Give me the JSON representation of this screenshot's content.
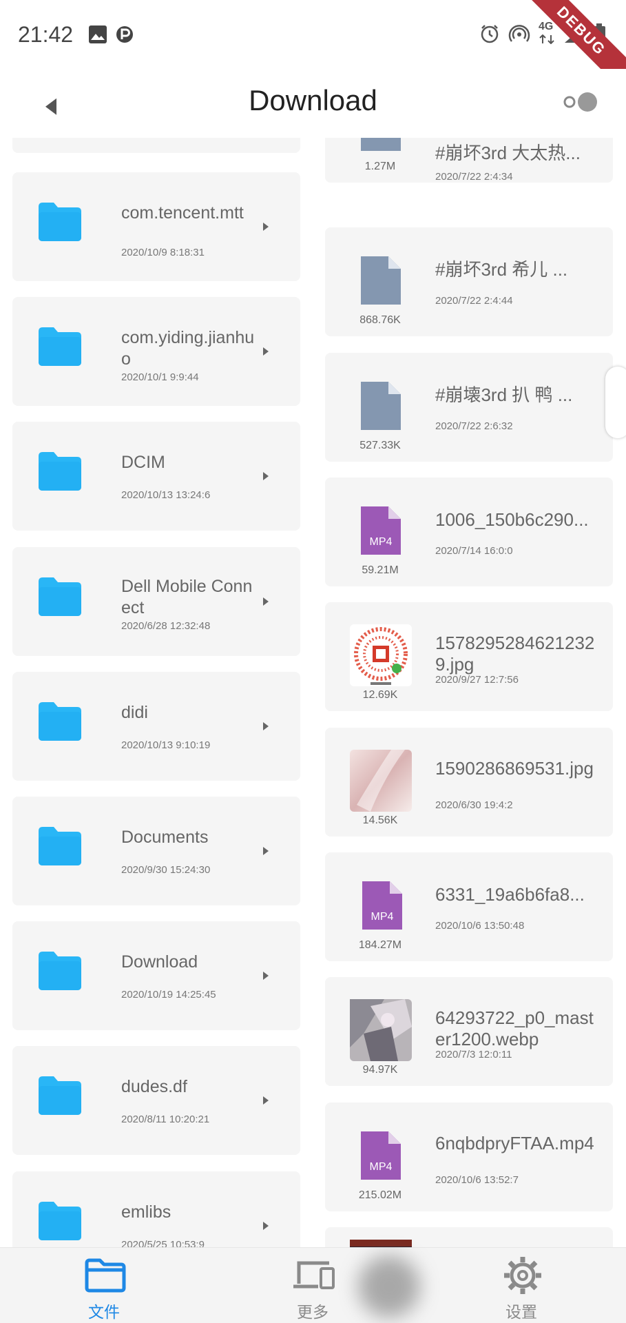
{
  "status_bar": {
    "time": "21:42",
    "left_icons": [
      "image-icon",
      "parking-p-icon"
    ],
    "right_icons": [
      "alarm-icon",
      "hotspot-icon",
      "4g-signal-icon",
      "signal-icon",
      "battery-icon"
    ],
    "network_label": "4G",
    "debug_banner": "DEBUG"
  },
  "app_bar": {
    "title": "Download",
    "back_icon": "back-triangle-icon",
    "toggle_icon": "view-toggle-icon"
  },
  "colors": {
    "folder": "#29b6f6",
    "generic_file": "#8497b0",
    "mp4": "#9c59b6",
    "nav_active": "#1e88e5",
    "nav_inactive": "#8a8a8a",
    "debug": "#b5323a"
  },
  "folders": [
    {
      "name": "",
      "date": ""
    },
    {
      "name": "com.tencent.mtt",
      "date": "2020/10/9 8:18:31"
    },
    {
      "name": "com.yiding.jianhuo",
      "date": "2020/10/1 9:9:44"
    },
    {
      "name": "DCIM",
      "date": "2020/10/13 13:24:6"
    },
    {
      "name": "Dell Mobile Connect",
      "date": "2020/6/28 12:32:48"
    },
    {
      "name": "didi",
      "date": "2020/10/13 9:10:19"
    },
    {
      "name": "Documents",
      "date": "2020/9/30 15:24:30"
    },
    {
      "name": "Download",
      "date": "2020/10/19 14:25:45"
    },
    {
      "name": "dudes.df",
      "date": "2020/8/11 10:20:21"
    },
    {
      "name": "emlibs",
      "date": "2020/5/25 10:53:9"
    }
  ],
  "files": [
    {
      "name": "#崩坏3rd 大太热...",
      "date": "2020/7/22 2:4:34",
      "size": "1.27M",
      "kind": "file"
    },
    {
      "name": "#崩坏3rd 希儿 ...",
      "date": "2020/7/22 2:4:44",
      "size": "868.76K",
      "kind": "file"
    },
    {
      "name": "#崩壊3rd 扒 鸭 ...",
      "date": "2020/7/22 2:6:32",
      "size": "527.33K",
      "kind": "file"
    },
    {
      "name": "1006_150b6c290...",
      "date": "2020/7/14 16:0:0",
      "size": "59.21M",
      "kind": "mp4"
    },
    {
      "name": "15782952846212329.jpg",
      "date": "2020/9/27 12:7:56",
      "size": "12.69K",
      "kind": "qr-image"
    },
    {
      "name": "1590286869531.jpg",
      "date": "2020/6/30 19:4:2",
      "size": "14.56K",
      "kind": "pink-image"
    },
    {
      "name": "6331_19a6b6fa8...",
      "date": "2020/10/6 13:50:48",
      "size": "184.27M",
      "kind": "mp4"
    },
    {
      "name": "64293722_p0_master1200.webp",
      "date": "2020/7/3 12:0:11",
      "size": "94.97K",
      "kind": "art-image"
    },
    {
      "name": "6nqbdpryFTAA.mp4",
      "date": "2020/10/6 13:52:7",
      "size": "215.02M",
      "kind": "mp4"
    },
    {
      "name": "",
      "date": "",
      "size": "",
      "kind": "dark-image"
    }
  ],
  "mp4_badge": "MP4",
  "bottom_nav": [
    {
      "label": "文件",
      "icon": "folder-icon",
      "active": true
    },
    {
      "label": "更多",
      "icon": "devices-icon",
      "active": false
    },
    {
      "label": "设置",
      "icon": "gear-icon",
      "active": false
    }
  ]
}
